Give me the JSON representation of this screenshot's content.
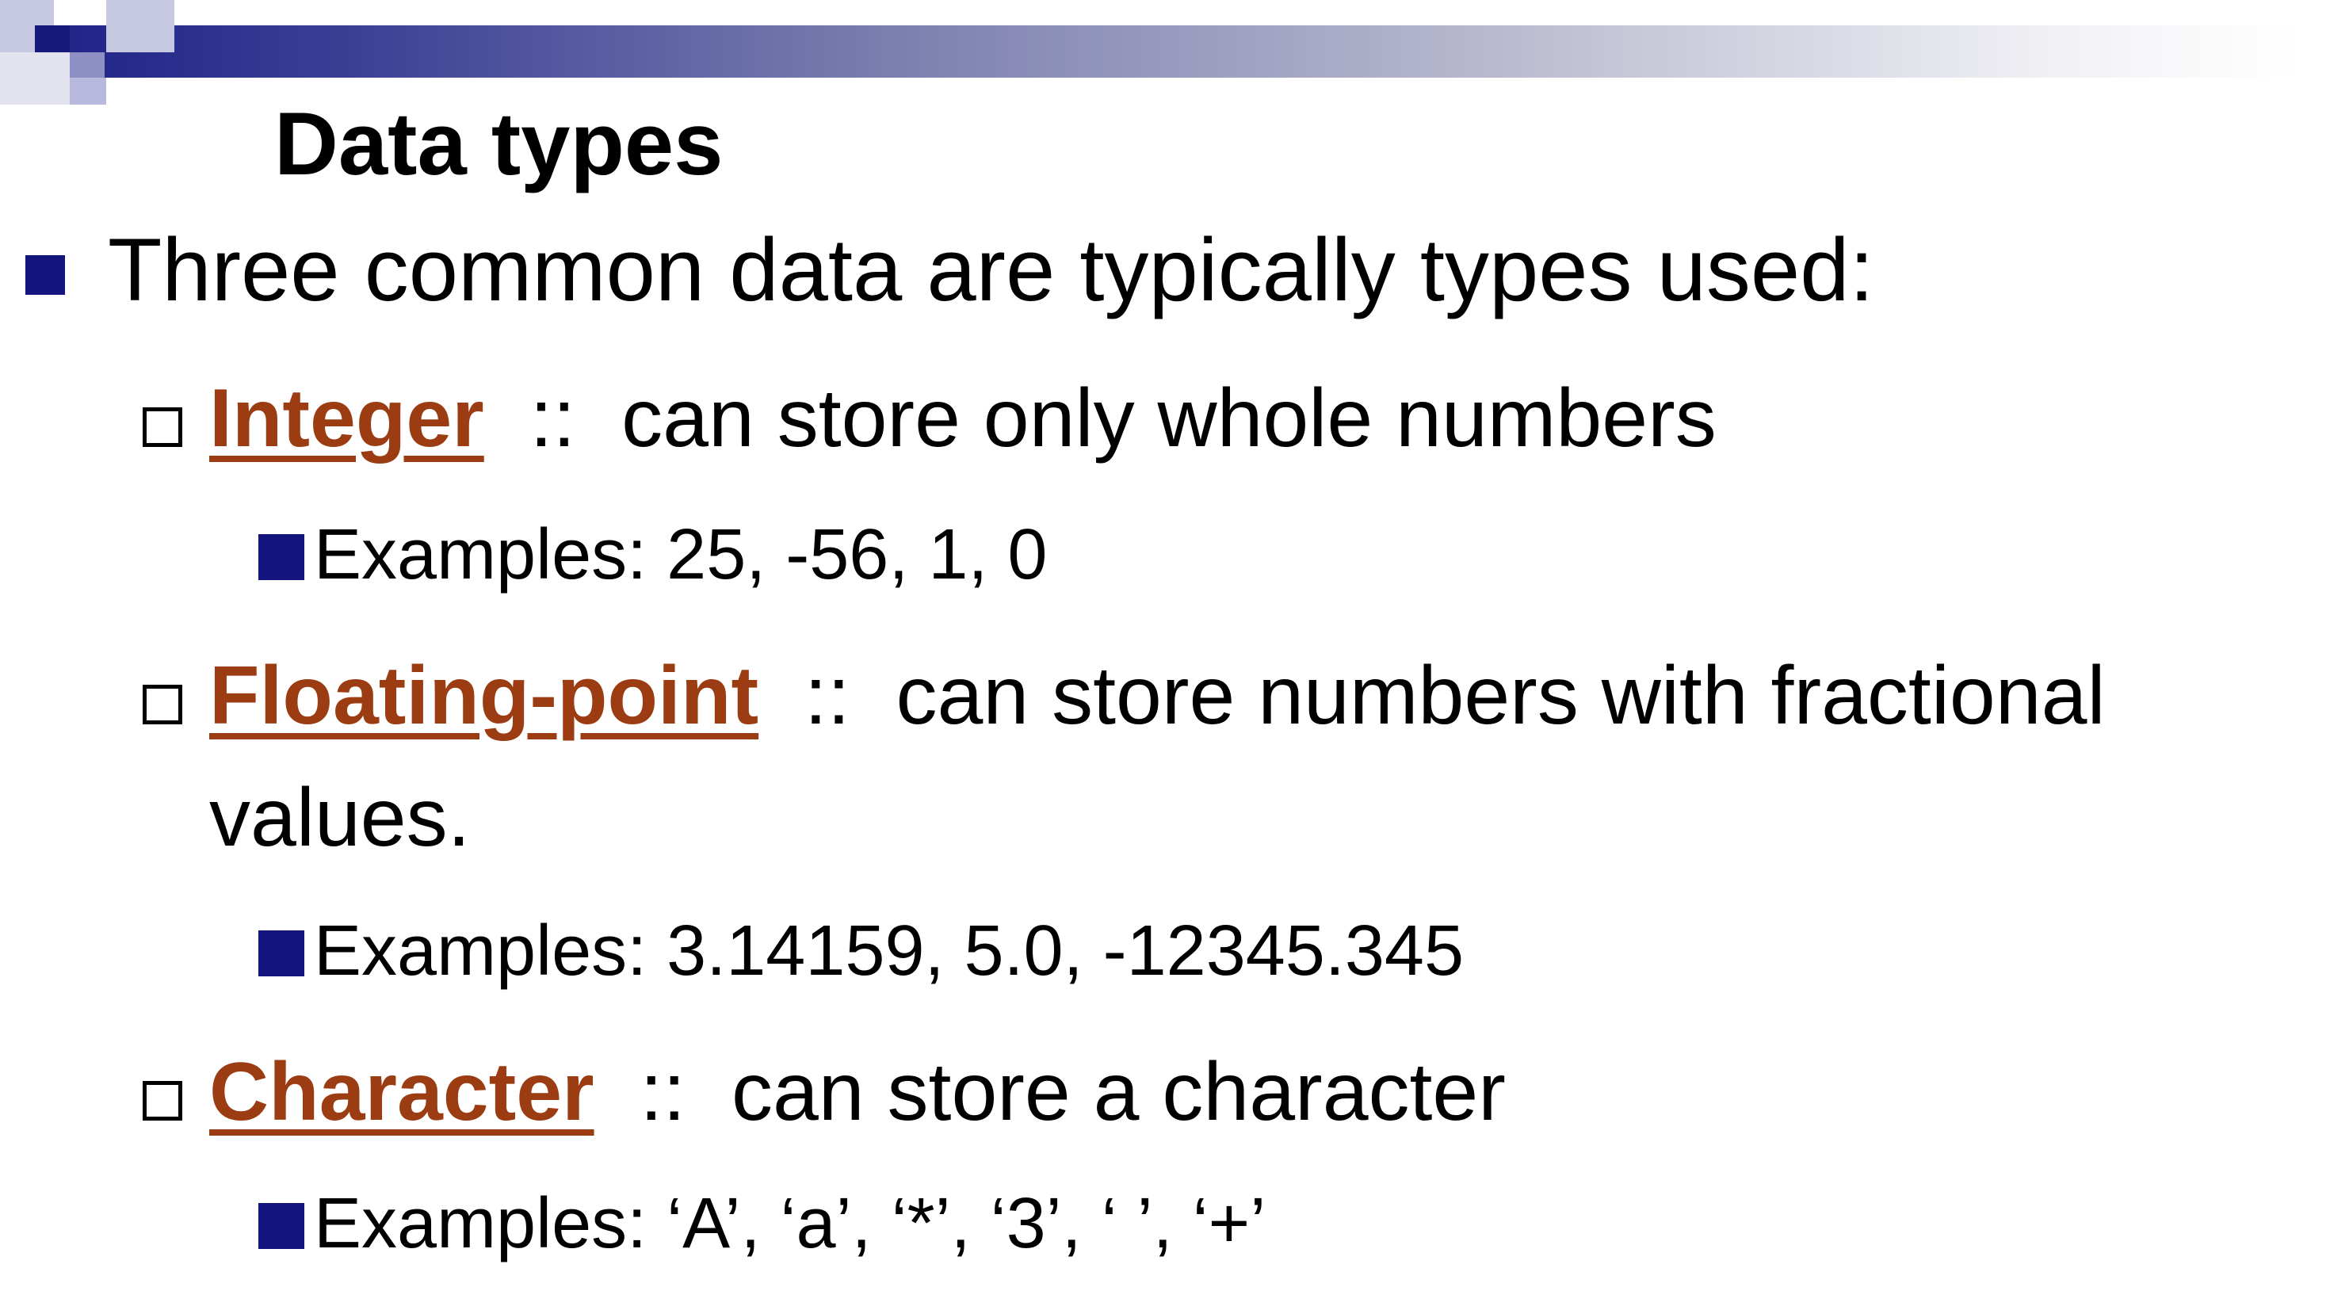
{
  "slide": {
    "title": "Data types",
    "intro": "Three common data are typically types used:",
    "items": [
      {
        "term": "Integer",
        "separator": "::",
        "description": "can store only whole numbers",
        "examples": "Examples:  25,  -56,  1,  0"
      },
      {
        "term": "Floating-point",
        "separator": "::",
        "description": "can store numbers with fractional",
        "description_cont": "values.",
        "examples": "Examples: 3.14159,  5.0,  -12345.345"
      },
      {
        "term": "Character",
        "separator": "::",
        "description": "can store a character",
        "examples": "Examples: ‘A’,  ‘a’,  ‘*’,  ‘3’,  ‘ ’,  ‘+’"
      }
    ]
  },
  "colors": {
    "term": "#9b3c12",
    "bullet": "#14147f",
    "text": "#000000",
    "header_band_start": "#1a1f85"
  },
  "icons": {
    "level1_bullet": "filled-square-icon",
    "level2_bullet": "hollow-square-icon",
    "level3_bullet": "filled-square-icon"
  }
}
